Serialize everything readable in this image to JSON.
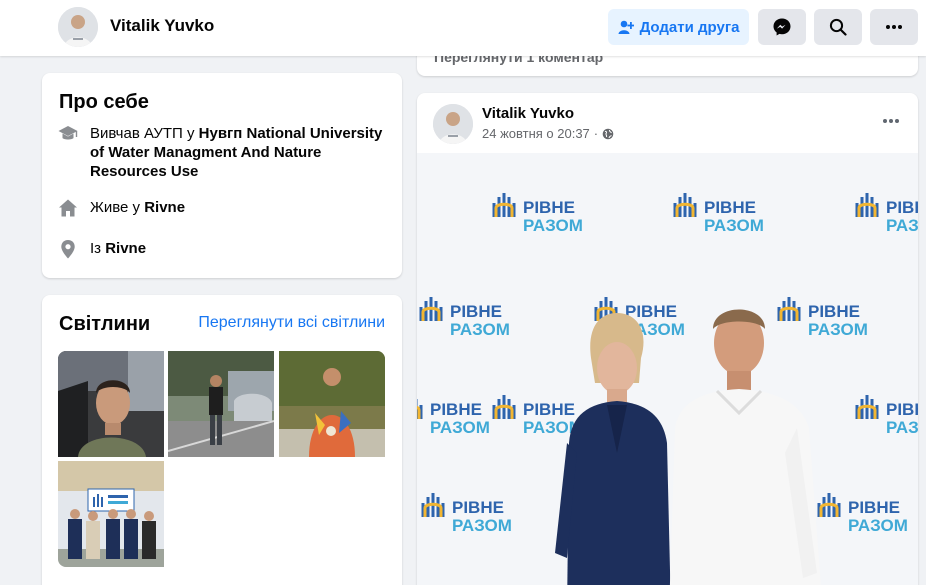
{
  "header": {
    "profile_name": "Vitalik Yuvko",
    "add_friend_label": "Додати друга",
    "messenger_icon": "messenger-icon",
    "search_icon": "search-icon",
    "more_icon": "more-icon"
  },
  "about": {
    "title": "Про себе",
    "education_prefix": "Вивчав АУТП у ",
    "education_place": "Нувгп National University of Water Managment And Nature Resources Use",
    "lives_prefix": "Живе у ",
    "lives_place": "Rivne",
    "from_prefix": "Із ",
    "from_place": "Rivne"
  },
  "photos": {
    "title": "Світлини",
    "see_all": "Переглянути всі світлини"
  },
  "previous_post": {
    "comments_link": "Переглянути 1 коментар"
  },
  "post": {
    "author": "Vitalik Yuvko",
    "timestamp": "24 жовтня о 20:37",
    "backdrop_logo_top": "РІВНЕ",
    "backdrop_logo_bottom": "РАЗОМ"
  },
  "colors": {
    "accent": "#1877f2",
    "accent_light": "#e7f3ff",
    "background": "#f0f2f5",
    "secondary_text": "#65676b",
    "logo_blue": "#2e64ad",
    "logo_cyan": "#3fa9d6",
    "logo_yellow": "#f2b632"
  }
}
